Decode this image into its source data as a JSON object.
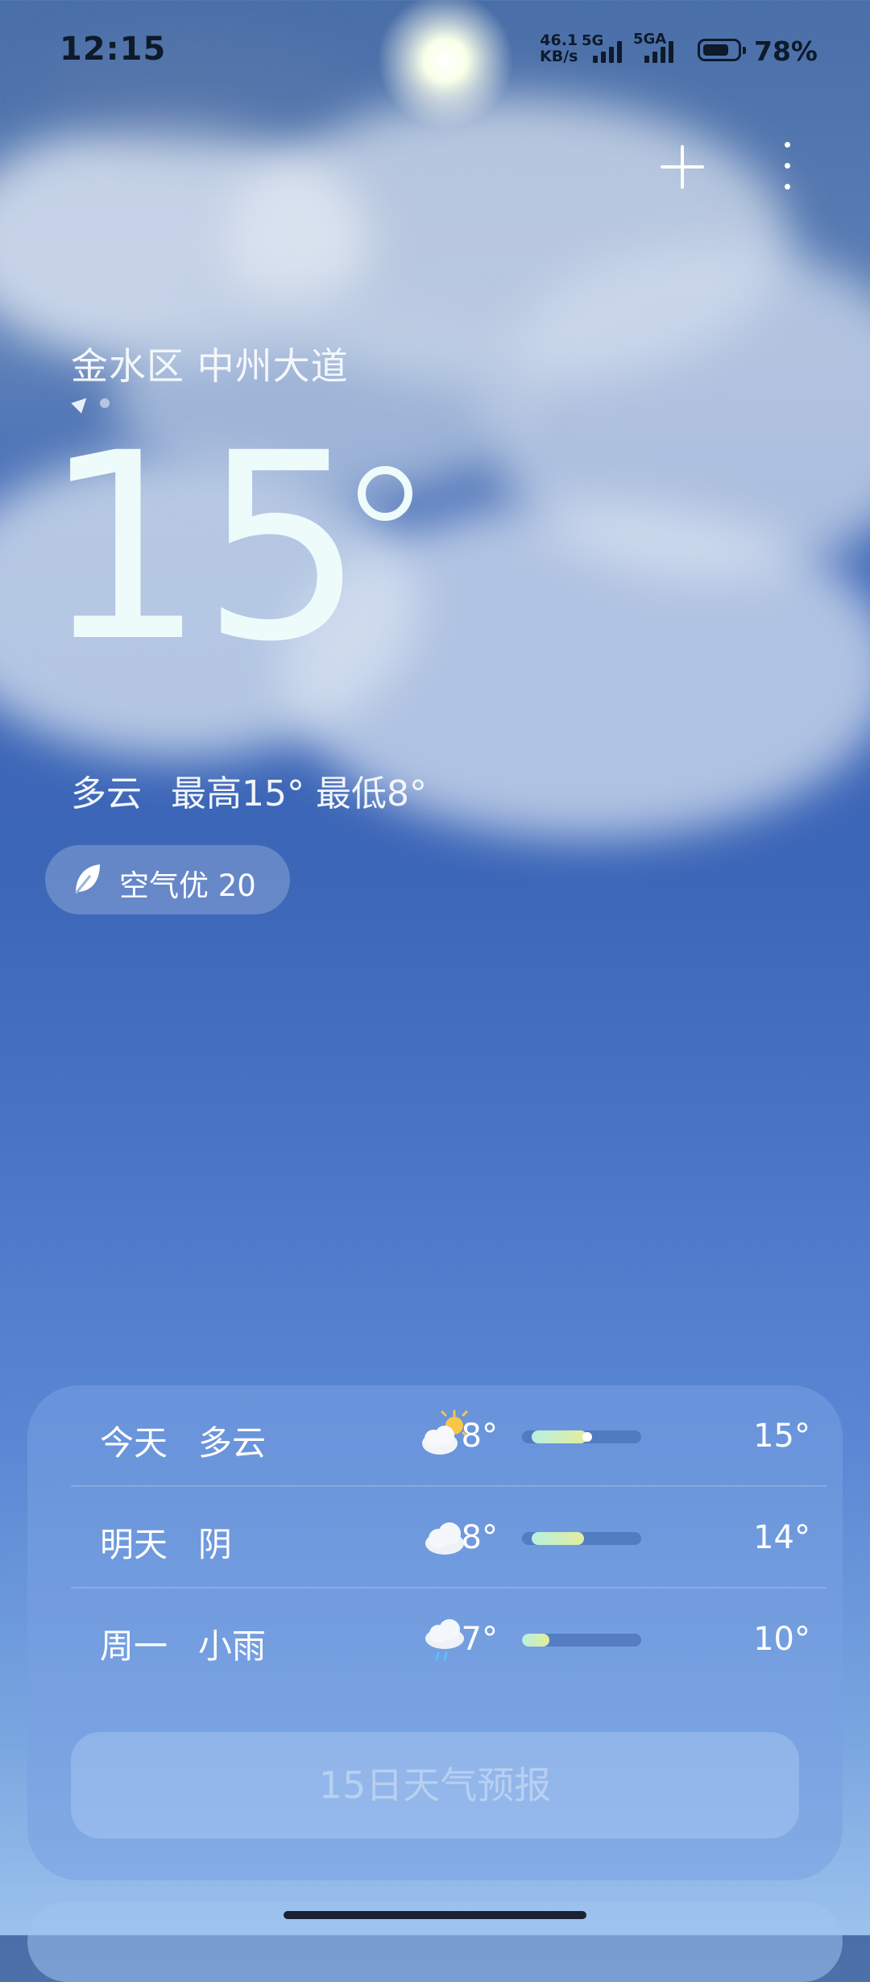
{
  "status_bar": {
    "time": "12:15",
    "net_speed_value": "46.1",
    "net_speed_unit": "KB/s",
    "sim1_label": "5G",
    "sim2_label": "5GA",
    "battery_level": 0.78,
    "battery_text": "78%"
  },
  "header": {
    "add_icon": "plus-icon",
    "more_icon": "more-vertical-icon"
  },
  "current": {
    "location": "金水区 中州大道",
    "temperature": "15",
    "condition": "多云",
    "high_low": "最高15° 最低8°",
    "aqi_label": "空气优 20",
    "aqi_icon": "leaf-icon"
  },
  "forecast": {
    "rows": [
      {
        "day": "今天",
        "condition": "多云",
        "icon": "partly-cloudy-icon",
        "low": "8°",
        "high": "15°",
        "bar_start": 0.08,
        "bar_end": 0.55,
        "now": 0.55
      },
      {
        "day": "明天",
        "condition": "阴",
        "icon": "cloudy-icon",
        "low": "8°",
        "high": "14°",
        "bar_start": 0.08,
        "bar_end": 0.52
      },
      {
        "day": "周一",
        "condition": "小雨",
        "icon": "light-rain-icon",
        "low": "7°",
        "high": "10°",
        "bar_start": 0.0,
        "bar_end": 0.23
      }
    ],
    "button_label": "15日天气预报"
  },
  "colors": {
    "bar_gradient_start": "#b8efe2",
    "bar_gradient_end": "#e2ee9a",
    "status_text": "#0e1a2a"
  }
}
